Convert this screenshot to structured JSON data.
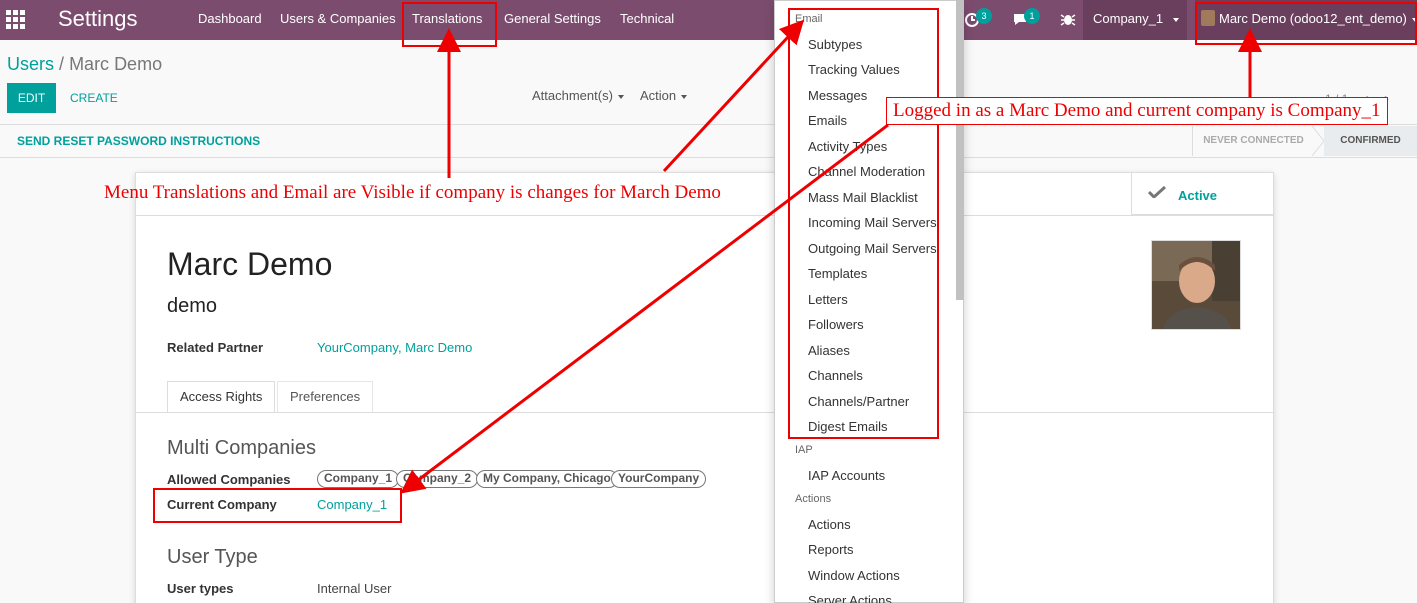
{
  "navbar": {
    "app_name": "Settings",
    "menus": [
      "Dashboard",
      "Users & Companies",
      "Translations",
      "General Settings",
      "Technical"
    ],
    "activity_count": "3",
    "message_count": "1",
    "company": "Company_1",
    "user": "Marc Demo (odoo12_ent_demo)"
  },
  "breadcrumb": {
    "parent": "Users",
    "separator": "/",
    "current": "Marc Demo"
  },
  "buttons": {
    "edit": "EDIT",
    "create": "CREATE",
    "reset_password": "SEND RESET PASSWORD INSTRUCTIONS"
  },
  "control_panel": {
    "attachments": "Attachment(s)",
    "action": "Action",
    "pager": "1 / 1"
  },
  "statusbar": {
    "stages": [
      "NEVER CONNECTED",
      "CONFIRMED"
    ],
    "current": "CONFIRMED"
  },
  "form": {
    "active_label": "Active",
    "name": "Marc Demo",
    "login": "demo",
    "related_partner_label": "Related Partner",
    "related_partner_value": "YourCompany, Marc Demo",
    "tabs": [
      "Access Rights",
      "Preferences"
    ],
    "multi_companies_title": "Multi Companies",
    "allowed_companies_label": "Allowed Companies",
    "allowed_companies": [
      "Company_1",
      "Company_2",
      "My Company, Chicago",
      "YourCompany"
    ],
    "current_company_label": "Current Company",
    "current_company_value": "Company_1",
    "user_type_title": "User Type",
    "user_types_label": "User types",
    "user_types_value": "Internal User"
  },
  "dropdown": {
    "email_header": "Email",
    "email_items": [
      "Subtypes",
      "Tracking Values",
      "Messages",
      "Emails",
      "Activity Types",
      "Channel Moderation",
      "Mass Mail Blacklist",
      "Incoming Mail Servers",
      "Outgoing Mail Servers",
      "Templates",
      "Letters",
      "Followers",
      "Aliases",
      "Channels",
      "Channels/Partner",
      "Digest Emails"
    ],
    "iap_header": "IAP",
    "iap_items": [
      "IAP Accounts"
    ],
    "actions_header": "Actions",
    "actions_items": [
      "Actions",
      "Reports",
      "Window Actions",
      "Server Actions"
    ]
  },
  "annotations": {
    "menu_note": "Menu Translations and Email are Visible if company is changes for March Demo",
    "login_note": "Logged in as a Marc Demo and current company is Company_1"
  },
  "colors": {
    "navbar": "#7c4c6f",
    "accent": "#00a09d",
    "annotation": "#ee0000"
  }
}
